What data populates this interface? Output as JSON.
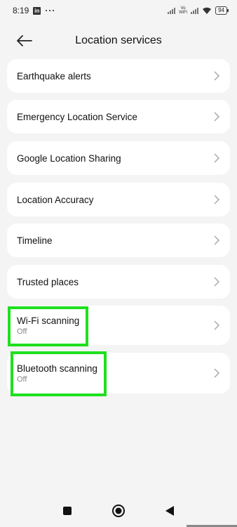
{
  "status_bar": {
    "time": "8:19",
    "app_badge": "in",
    "more": "···",
    "vowifi_top": "Vo",
    "vowifi_bottom": "WiFi",
    "battery": "94"
  },
  "header": {
    "title": "Location services",
    "back_icon": "arrow-left-icon"
  },
  "items": [
    {
      "label": "Earthquake alerts",
      "sub": ""
    },
    {
      "label": "Emergency Location Service",
      "sub": ""
    },
    {
      "label": "Google Location Sharing",
      "sub": ""
    },
    {
      "label": "Location Accuracy",
      "sub": ""
    },
    {
      "label": "Timeline",
      "sub": ""
    },
    {
      "label": "Trusted places",
      "sub": ""
    },
    {
      "label": "Wi-Fi scanning",
      "sub": "Off"
    },
    {
      "label": "Bluetooth scanning",
      "sub": "Off"
    }
  ],
  "colors": {
    "background": "#f4f4f4",
    "card": "#ffffff",
    "highlight": "#1ee01e",
    "subtext": "#888888"
  },
  "nav": {
    "recents_icon": "square-icon",
    "home_icon": "circle-icon",
    "back_icon": "triangle-back-icon"
  }
}
